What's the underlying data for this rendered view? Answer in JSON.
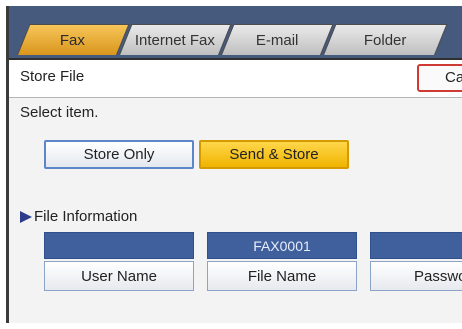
{
  "tabs": [
    {
      "label": "Fax",
      "active": true
    },
    {
      "label": "Internet Fax",
      "active": false
    },
    {
      "label": "E-mail",
      "active": false
    },
    {
      "label": "Folder",
      "active": false
    }
  ],
  "header": {
    "title": "Store File",
    "cancel_label": "Car"
  },
  "main": {
    "instruction": "Select item.",
    "options": [
      {
        "label": "Store Only",
        "selected": false
      },
      {
        "label": "Send & Store",
        "selected": true
      }
    ],
    "section_title": "File Information",
    "fields": [
      {
        "value": "",
        "label": "User Name"
      },
      {
        "value": "FAX0001",
        "label": "File Name"
      },
      {
        "value": "",
        "label": "Passwor"
      }
    ]
  },
  "colors": {
    "accent": "#f0b400",
    "tab_bar": "#465a7d",
    "value_box": "#3f5f9d",
    "cancel_border": "#cf3b33"
  },
  "icons": {
    "section_marker": "triangle-right-icon"
  }
}
